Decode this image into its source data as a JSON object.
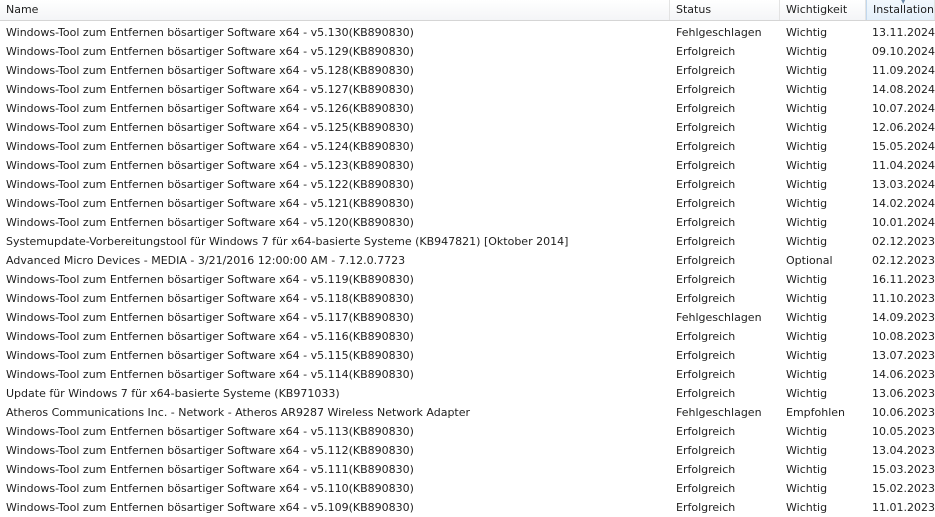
{
  "columns": {
    "name": "Name",
    "status": "Status",
    "importance": "Wichtigkeit",
    "date": "Installationsdatum"
  },
  "rows": [
    {
      "name": "Windows-Tool zum Entfernen bösartiger Software x64 - v5.130(KB890830)",
      "status": "Fehlgeschlagen",
      "importance": "Wichtig",
      "date": "13.11.2024"
    },
    {
      "name": "Windows-Tool zum Entfernen bösartiger Software x64 - v5.129(KB890830)",
      "status": "Erfolgreich",
      "importance": "Wichtig",
      "date": "09.10.2024"
    },
    {
      "name": "Windows-Tool zum Entfernen bösartiger Software x64 - v5.128(KB890830)",
      "status": "Erfolgreich",
      "importance": "Wichtig",
      "date": "11.09.2024"
    },
    {
      "name": "Windows-Tool zum Entfernen bösartiger Software x64 - v5.127(KB890830)",
      "status": "Erfolgreich",
      "importance": "Wichtig",
      "date": "14.08.2024"
    },
    {
      "name": "Windows-Tool zum Entfernen bösartiger Software x64 - v5.126(KB890830)",
      "status": "Erfolgreich",
      "importance": "Wichtig",
      "date": "10.07.2024"
    },
    {
      "name": "Windows-Tool zum Entfernen bösartiger Software x64 - v5.125(KB890830)",
      "status": "Erfolgreich",
      "importance": "Wichtig",
      "date": "12.06.2024"
    },
    {
      "name": "Windows-Tool zum Entfernen bösartiger Software x64 - v5.124(KB890830)",
      "status": "Erfolgreich",
      "importance": "Wichtig",
      "date": "15.05.2024"
    },
    {
      "name": "Windows-Tool zum Entfernen bösartiger Software x64 - v5.123(KB890830)",
      "status": "Erfolgreich",
      "importance": "Wichtig",
      "date": "11.04.2024"
    },
    {
      "name": "Windows-Tool zum Entfernen bösartiger Software x64 - v5.122(KB890830)",
      "status": "Erfolgreich",
      "importance": "Wichtig",
      "date": "13.03.2024"
    },
    {
      "name": "Windows-Tool zum Entfernen bösartiger Software x64 - v5.121(KB890830)",
      "status": "Erfolgreich",
      "importance": "Wichtig",
      "date": "14.02.2024"
    },
    {
      "name": "Windows-Tool zum Entfernen bösartiger Software x64 - v5.120(KB890830)",
      "status": "Erfolgreich",
      "importance": "Wichtig",
      "date": "10.01.2024"
    },
    {
      "name": "Systemupdate-Vorbereitungstool für Windows 7 für x64-basierte Systeme (KB947821) [Oktober 2014]",
      "status": "Erfolgreich",
      "importance": "Wichtig",
      "date": "02.12.2023"
    },
    {
      "name": "Advanced Micro Devices - MEDIA - 3/21/2016 12:00:00 AM - 7.12.0.7723",
      "status": "Erfolgreich",
      "importance": "Optional",
      "date": "02.12.2023"
    },
    {
      "name": "Windows-Tool zum Entfernen bösartiger Software x64 - v5.119(KB890830)",
      "status": "Erfolgreich",
      "importance": "Wichtig",
      "date": "16.11.2023"
    },
    {
      "name": "Windows-Tool zum Entfernen bösartiger Software x64 - v5.118(KB890830)",
      "status": "Erfolgreich",
      "importance": "Wichtig",
      "date": "11.10.2023"
    },
    {
      "name": "Windows-Tool zum Entfernen bösartiger Software x64 - v5.117(KB890830)",
      "status": "Fehlgeschlagen",
      "importance": "Wichtig",
      "date": "14.09.2023"
    },
    {
      "name": "Windows-Tool zum Entfernen bösartiger Software x64 - v5.116(KB890830)",
      "status": "Erfolgreich",
      "importance": "Wichtig",
      "date": "10.08.2023"
    },
    {
      "name": "Windows-Tool zum Entfernen bösartiger Software x64 - v5.115(KB890830)",
      "status": "Erfolgreich",
      "importance": "Wichtig",
      "date": "13.07.2023"
    },
    {
      "name": "Windows-Tool zum Entfernen bösartiger Software x64 - v5.114(KB890830)",
      "status": "Erfolgreich",
      "importance": "Wichtig",
      "date": "14.06.2023"
    },
    {
      "name": "Update für Windows 7 für x64-basierte Systeme (KB971033)",
      "status": "Erfolgreich",
      "importance": "Wichtig",
      "date": "13.06.2023"
    },
    {
      "name": "Atheros Communications Inc. - Network - Atheros AR9287 Wireless Network Adapter",
      "status": "Fehlgeschlagen",
      "importance": "Empfohlen",
      "date": "10.06.2023"
    },
    {
      "name": "Windows-Tool zum Entfernen bösartiger Software x64 - v5.113(KB890830)",
      "status": "Erfolgreich",
      "importance": "Wichtig",
      "date": "10.05.2023"
    },
    {
      "name": "Windows-Tool zum Entfernen bösartiger Software x64 - v5.112(KB890830)",
      "status": "Erfolgreich",
      "importance": "Wichtig",
      "date": "13.04.2023"
    },
    {
      "name": "Windows-Tool zum Entfernen bösartiger Software x64 - v5.111(KB890830)",
      "status": "Erfolgreich",
      "importance": "Wichtig",
      "date": "15.03.2023"
    },
    {
      "name": "Windows-Tool zum Entfernen bösartiger Software x64 - v5.110(KB890830)",
      "status": "Erfolgreich",
      "importance": "Wichtig",
      "date": "15.02.2023"
    },
    {
      "name": "Windows-Tool zum Entfernen bösartiger Software x64 - v5.109(KB890830)",
      "status": "Erfolgreich",
      "importance": "Wichtig",
      "date": "11.01.2023"
    }
  ]
}
